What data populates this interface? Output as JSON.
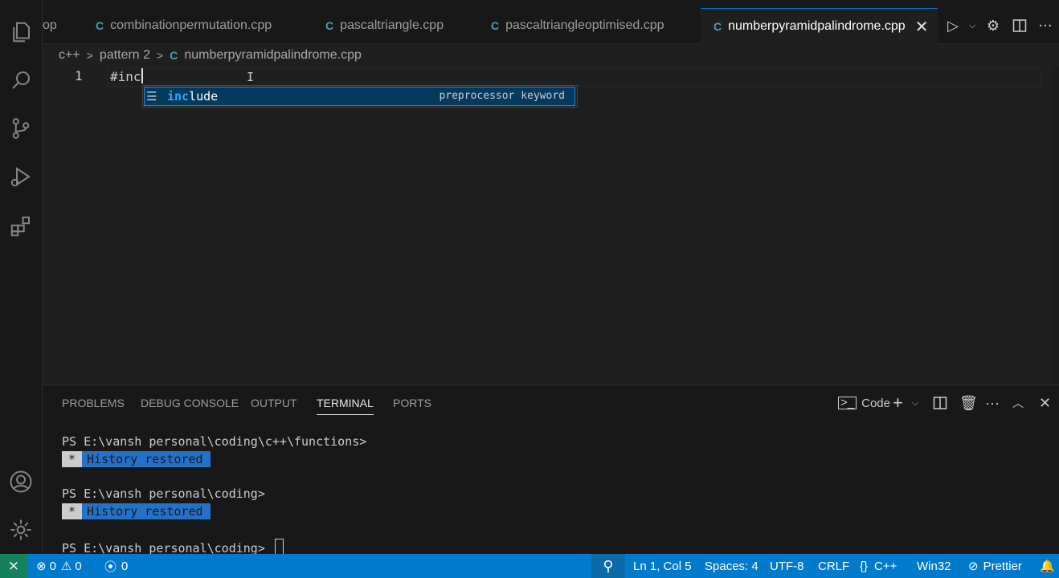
{
  "tabs": [
    {
      "label": "op",
      "icon": "cpp-file-icon"
    },
    {
      "label": "combinationpermutation.cpp",
      "icon": "cpp-file-icon"
    },
    {
      "label": "pascaltriangle.cpp",
      "icon": "cpp-file-icon"
    },
    {
      "label": "pascaltriangleoptimised.cpp",
      "icon": "cpp-file-icon"
    },
    {
      "label": "numberpyramidpalindrome.cpp",
      "icon": "cpp-file-icon",
      "active": true
    }
  ],
  "breadcrumb": [
    "c++",
    "pattern 2",
    "numberpyramidpalindrome.cpp"
  ],
  "editor": {
    "line_number": "1",
    "code": "#inc",
    "suggestion": {
      "match": "inc",
      "rest": "lude",
      "detail": "preprocessor keyword"
    }
  },
  "panel": {
    "tabs": [
      "PROBLEMS",
      "DEBUG CONSOLE",
      "OUTPUT",
      "TERMINAL",
      "PORTS"
    ],
    "active_tab": "TERMINAL",
    "terminal_name": "Code",
    "lines": [
      "PS E:\\vansh personal\\coding\\c++\\functions>",
      "PS E:\\vansh personal\\coding>",
      "PS E:\\vansh personal\\coding> "
    ],
    "history_star": "*",
    "history_msg": "History restored"
  },
  "status": {
    "errors": "0",
    "warnings": "0",
    "ports": "0",
    "position": "Ln 1, Col 5",
    "spaces": "Spaces: 4",
    "encoding": "UTF-8",
    "eol": "CRLF",
    "language": "C++",
    "platform": "Win32",
    "formatter": "Prettier"
  },
  "colors": {
    "accent": "#007acc",
    "remote": "#16825d",
    "highlight": "#2aaaff"
  }
}
